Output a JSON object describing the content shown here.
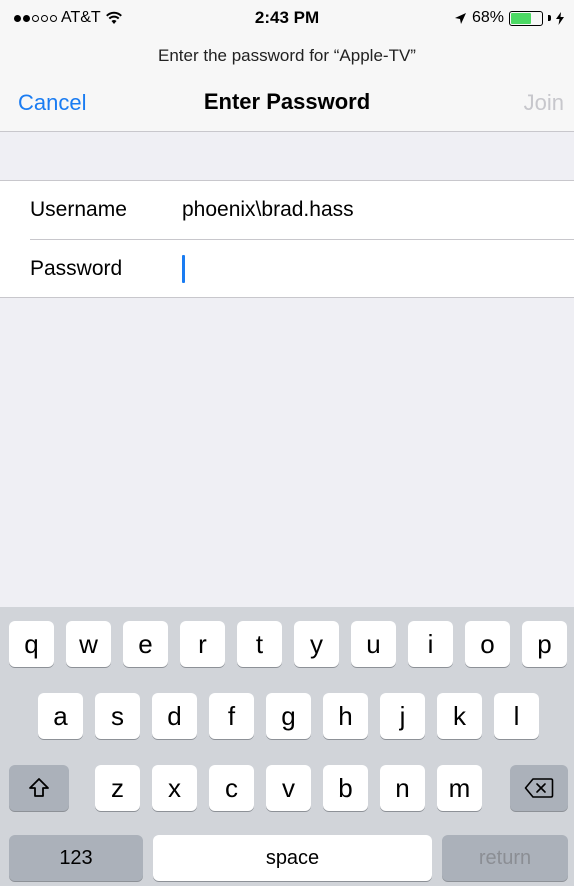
{
  "status_bar": {
    "carrier": "AT&T",
    "time": "2:43 PM",
    "battery_percent": "68%",
    "battery_level": 0.68,
    "icons": [
      "signal-dots-icon",
      "wifi-icon",
      "location-arrow-icon",
      "battery-icon",
      "charging-bolt-icon"
    ]
  },
  "prompt": "Enter the password for “Apple-TV”",
  "nav": {
    "cancel_label": "Cancel",
    "title": "Enter Password",
    "join_label": "Join"
  },
  "form": {
    "username_label": "Username",
    "username_value": "phoenix\\brad.hass",
    "password_label": "Password",
    "password_value": ""
  },
  "keyboard": {
    "row1": [
      "q",
      "w",
      "e",
      "r",
      "t",
      "y",
      "u",
      "i",
      "o",
      "p"
    ],
    "row2": [
      "a",
      "s",
      "d",
      "f",
      "g",
      "h",
      "j",
      "k",
      "l"
    ],
    "row3": [
      "z",
      "x",
      "c",
      "v",
      "b",
      "n",
      "m"
    ],
    "numbers_label": "123",
    "space_label": "space",
    "return_label": "return",
    "shift_icon": "shift-icon",
    "delete_icon": "delete-icon"
  },
  "colors": {
    "accent": "#1a7cf2",
    "disabled": "#c7c7cc",
    "battery": "#4cd964"
  }
}
